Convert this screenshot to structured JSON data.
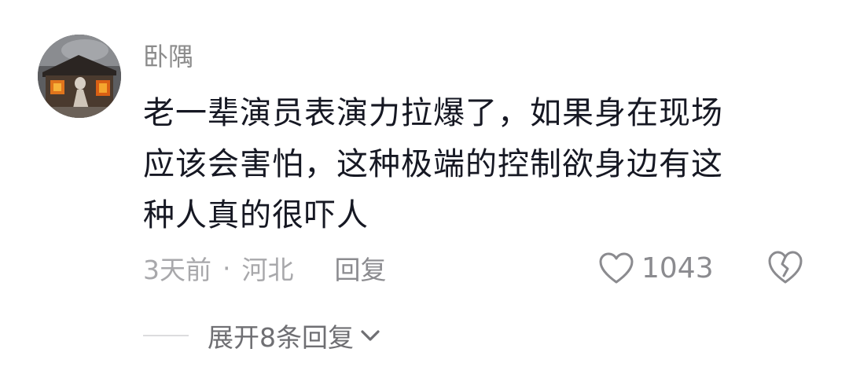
{
  "comment": {
    "username": "卧隅",
    "text_lines": [
      "老一辈演员表演力拉爆了，如果身在现场",
      "应该会害怕，这种极端的控制欲身边有这",
      "种人真的很吓人"
    ],
    "time": "3天前",
    "separator": "·",
    "location": "河北",
    "reply_label": "回复",
    "like_count": "1043",
    "expand_label": "展开8条回复"
  },
  "icons": {
    "avatar": "burning-house-avatar",
    "like": "heart-outline-icon",
    "dislike": "broken-heart-icon",
    "expand": "chevron-down-icon"
  },
  "colors": {
    "text_primary": "#161823",
    "text_secondary": "#8c8c8c",
    "icon": "#8b8b8f"
  }
}
